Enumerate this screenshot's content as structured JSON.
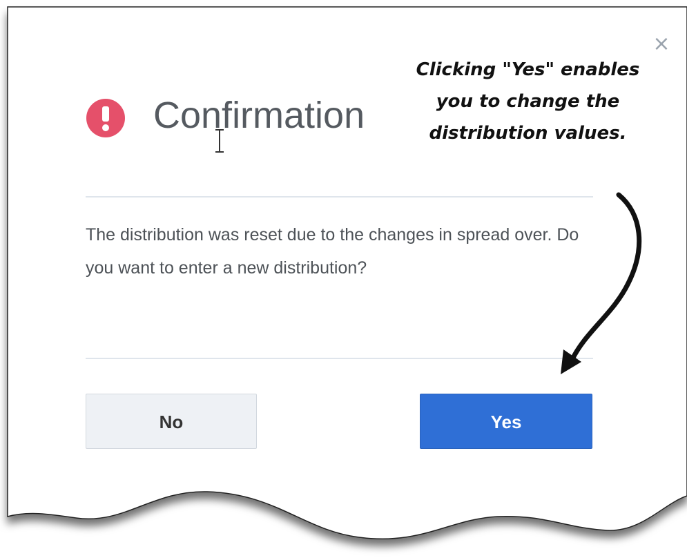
{
  "dialog": {
    "title": "Confirmation",
    "message": "The distribution was reset due to the changes in spread over. Do you want to enter a new distribution?",
    "close_symbol": "×",
    "icon": "alert-circle-icon",
    "buttons": {
      "no_label": "No",
      "yes_label": "Yes"
    }
  },
  "annotation": {
    "lines": [
      "Clicking \"Yes\" enables",
      "you to change the",
      "distribution values."
    ]
  },
  "colors": {
    "alert": "#e5506a",
    "primary": "#2f6fd6",
    "secondary": "#eef1f5",
    "title_text": "#555a60",
    "body_text": "#4d5257"
  }
}
